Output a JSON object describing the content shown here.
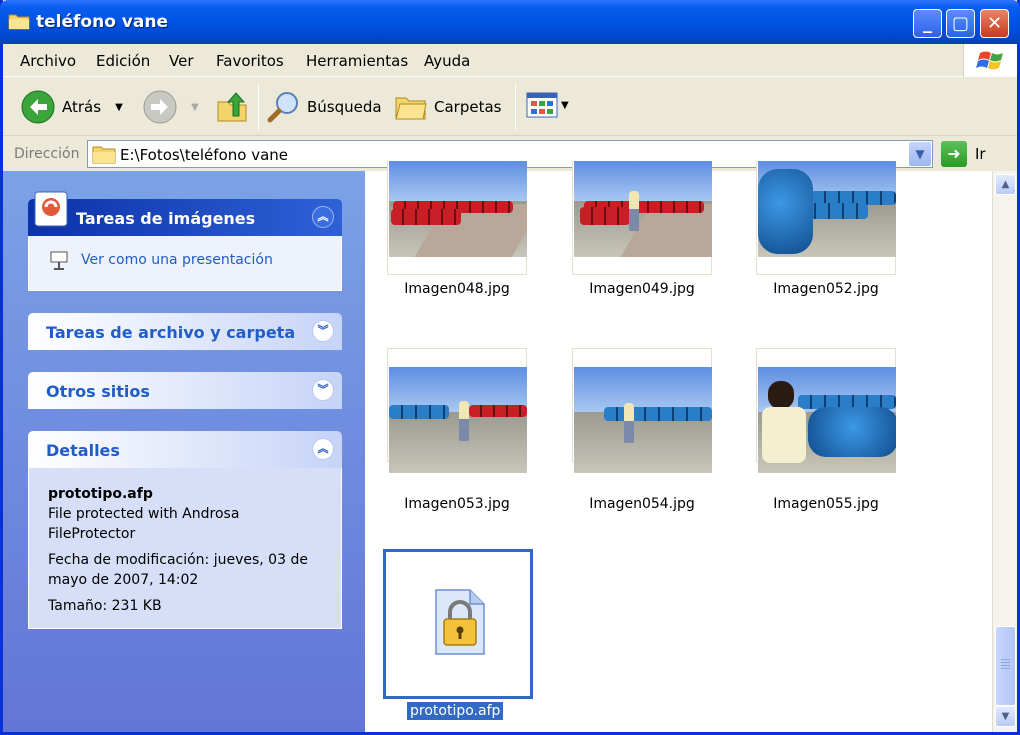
{
  "window": {
    "title": "teléfono vane"
  },
  "menu": [
    "Archivo",
    "Edición",
    "Ver",
    "Favoritos",
    "Herramientas",
    "Ayuda"
  ],
  "toolbar": {
    "back_label": "Atrás",
    "search_label": "Búsqueda",
    "folders_label": "Carpetas"
  },
  "address": {
    "label": "Dirección",
    "path": "E:\\Fotos\\teléfono vane",
    "go_label": "Ir"
  },
  "tasks": {
    "image_tasks_title": "Tareas de imágenes",
    "slideshow_label": "Ver como una presentación",
    "file_tasks_title": "Tareas de archivo y carpeta",
    "other_places_title": "Otros sitios",
    "details_title": "Detalles"
  },
  "details": {
    "filename": "prototipo.afp",
    "description": "File protected with Androsa FileProtector",
    "modified": "Fecha de modificación: jueves, 03 de mayo de 2007, 14:02",
    "size": "Tamaño: 231 KB"
  },
  "files": [
    {
      "name": "Imagen048.jpg"
    },
    {
      "name": "Imagen049.jpg"
    },
    {
      "name": "Imagen052.jpg"
    },
    {
      "name": "Imagen053.jpg"
    },
    {
      "name": "Imagen054.jpg"
    },
    {
      "name": "Imagen055.jpg"
    },
    {
      "name": "prototipo.afp",
      "selected": true,
      "icon": "lock-file-icon"
    }
  ],
  "colors": {
    "title_bar": "#0054e3",
    "task_pane": "#6f8fe0",
    "selection": "#316ac5"
  }
}
